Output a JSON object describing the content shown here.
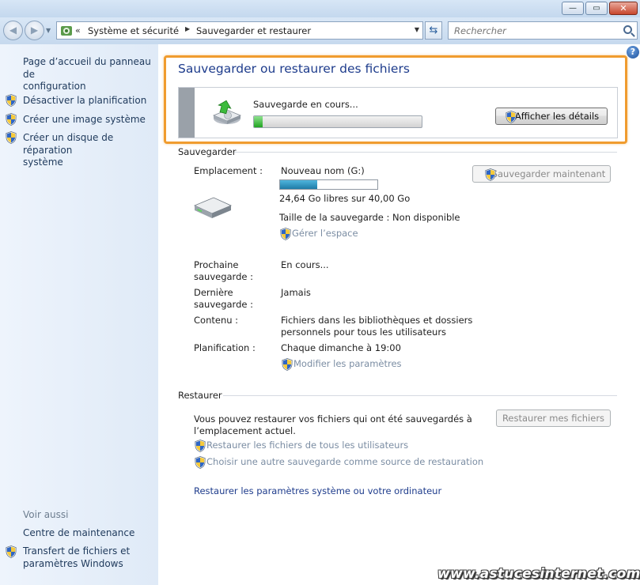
{
  "window": {
    "min_glyph": "—",
    "max_glyph": "▭",
    "close_glyph": "✕"
  },
  "nav": {
    "back_glyph": "◀",
    "forward_glyph": "▶",
    "breadcrumb_prefix": "«",
    "breadcrumb": [
      "Système et sécurité",
      "Sauvegarder et restaurer"
    ],
    "search_placeholder": "Rechercher"
  },
  "left_pane": {
    "home_link": [
      "Page d’accueil du panneau de",
      "configuration"
    ],
    "tasks": [
      {
        "label": [
          "Désactiver la planification"
        ],
        "icon": "uac-shield-icon"
      },
      {
        "label": [
          "Créer une image système"
        ],
        "icon": "uac-shield-icon"
      },
      {
        "label": [
          "Créer un disque de réparation",
          "système"
        ],
        "icon": "uac-shield-icon"
      }
    ],
    "see_also_title": "Voir aussi",
    "see_also": [
      {
        "label": [
          "Centre de maintenance"
        ],
        "icon": null
      },
      {
        "label": [
          "Transfert de fichiers et",
          "paramètres Windows"
        ],
        "icon": "uac-shield-icon"
      }
    ]
  },
  "main": {
    "title": "Sauvegarder ou restaurer des fichiers",
    "status": {
      "text": "Sauvegarde en cours...",
      "progress_fraction": 0.05,
      "details_button": "Afficher les détails"
    },
    "backup": {
      "section_title": "Sauvegarder",
      "location_label": "Emplacement :",
      "location_value": "Nouveau nom (G:)",
      "space_used_fraction": 0.38,
      "space_text": "24,64 Go libres sur 40,00 Go",
      "backup_size": "Taille de la sauvegarde : Non disponible",
      "manage_space": "Gérer l’espace",
      "backup_now_button": "Sauvegarder maintenant",
      "next_label": [
        "Prochaine",
        "sauvegarde :"
      ],
      "next_value": "En cours...",
      "last_label": [
        "Dernière",
        "sauvegarde :"
      ],
      "last_value": "Jamais",
      "contents_label": "Contenu :",
      "contents_value": [
        "Fichiers dans les bibliothèques et dossiers",
        "personnels pour tous les utilisateurs"
      ],
      "schedule_label": "Planification :",
      "schedule_value": "Chaque dimanche à 19:00",
      "change_settings": "Modifier les paramètres"
    },
    "restore": {
      "section_title": "Restaurer",
      "description": [
        "Vous pouvez restaurer vos fichiers qui ont été sauvegardés à",
        "l’emplacement actuel."
      ],
      "restore_button": "Restaurer mes fichiers",
      "restore_all_users": "Restaurer les fichiers de tous les utilisateurs",
      "choose_other": "Choisir une autre sauvegarde comme source de restauration",
      "recover_system": "Restaurer les paramètres système ou votre ordinateur"
    }
  },
  "help_glyph": "?",
  "watermark": "www.astucesinternet.com"
}
